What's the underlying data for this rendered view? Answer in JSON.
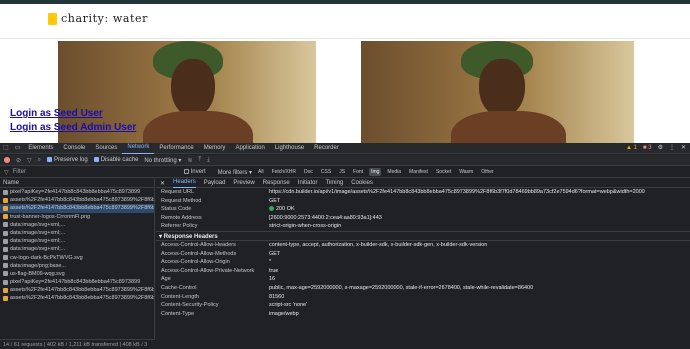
{
  "site": {
    "brand": "charity: water",
    "links": [
      "Login as Seed User",
      "Login as Seed Admin User"
    ]
  },
  "devtools": {
    "tabs": [
      "Elements",
      "Console",
      "Sources",
      "Network",
      "Performance",
      "Memory",
      "Application",
      "Lighthouse",
      "Recorder"
    ],
    "active_tab": "Network",
    "warnings": "1",
    "errors": "3",
    "toolbar": {
      "preserve_log": "Preserve log",
      "disable_cache": "Disable cache",
      "throttling": "No throttling"
    },
    "filter": {
      "placeholder": "Filter",
      "invert": "Invert",
      "more_filters": "More filters",
      "types": [
        "All",
        "Fetch/XHR",
        "Doc",
        "CSS",
        "JS",
        "Font",
        "Img",
        "Media",
        "Manifest",
        "Socket",
        "Wasm",
        "Other"
      ],
      "active_type": "Img"
    },
    "requests": {
      "header": "Name",
      "rows": [
        {
          "name": "pixel?apiKey=2fe4147bb8c843bb8ebba475c8973899",
          "icon_color": "#9aa0a6",
          "selected": false
        },
        {
          "name": "assets%2F2fe4147bb8c843bb8ebba475c8973899%2F8f6b3f7",
          "icon_color": "#e8a33d",
          "selected": false
        },
        {
          "name": "assets%2F2fe4147bb8c843bb8ebba475c8973899%2F8f6b3f7",
          "icon_color": "#e8a33d",
          "selected": true
        },
        {
          "name": "trust-banner-logos-CrronmFl.png",
          "icon_color": "#e8a33d",
          "selected": false
        },
        {
          "name": "data:image/svg+xml,...",
          "icon_color": "#9aa0a6",
          "selected": false
        },
        {
          "name": "data:image/svg+xml;...",
          "icon_color": "#9aa0a6",
          "selected": false
        },
        {
          "name": "data:image/svg+xml;...",
          "icon_color": "#9aa0a6",
          "selected": false
        },
        {
          "name": "data:image/svg+xml;...",
          "icon_color": "#9aa0a6",
          "selected": false
        },
        {
          "name": "cw-logo-dark-BcPkTWVG.svg",
          "icon_color": "#9aa0a6",
          "selected": false
        },
        {
          "name": "data:image/png;base...",
          "icon_color": "#9aa0a6",
          "selected": false
        },
        {
          "name": "us-flag-BM09-wqg.svg",
          "icon_color": "#9aa0a6",
          "selected": false
        },
        {
          "name": "pixel?apiKey=2fe4147bb8c843bb8ebba475c8973899",
          "icon_color": "#9aa0a6",
          "selected": false
        },
        {
          "name": "assets%2F2fe4147bb8c843bb8ebba475c8973899%2F8f6b3f7",
          "icon_color": "#e8a33d",
          "selected": false
        },
        {
          "name": "assets%2F2fe4147bb8c843bb8ebba475c8973899%2F8f6b3f7",
          "icon_color": "#e8a33d",
          "selected": false
        }
      ]
    },
    "status_bar": "14 / 61 requests | 402 kB / 1,211 kB transferred | 408 kB / 3",
    "detail_tabs": [
      "Headers",
      "Payload",
      "Preview",
      "Response",
      "Initiator",
      "Timing",
      "Cookies"
    ],
    "active_detail_tab": "Headers",
    "general": [
      {
        "k": "Request URL",
        "v": "https://cdn.builder.io/api/v1/image/assets%2F2fe4147bb8c843bb8ebba475c8973899%2F8f6b3f7f0d78469bb89a73cf2e7594d6?format=webp&width=2000"
      },
      {
        "k": "Request Method",
        "v": "GET"
      },
      {
        "k": "Status Code",
        "v": "200 OK"
      },
      {
        "k": "Remote Address",
        "v": "[2600:9000:2573:4400:2:cea4:aa80:93a1]:443"
      },
      {
        "k": "Referrer Policy",
        "v": "strict-origin-when-cross-origin"
      }
    ],
    "response_headers_title": "Response Headers",
    "response_headers": [
      {
        "k": "Access-Control-Allow-Headers",
        "v": "content-type, accept, authorization, x-builder-sdk, x-builder-sdk-gen, x-builder-sdk-version"
      },
      {
        "k": "Access-Control-Allow-Methods",
        "v": "GET"
      },
      {
        "k": "Access-Control-Allow-Origin",
        "v": "*"
      },
      {
        "k": "Access-Control-Allow-Private-Network",
        "v": "true"
      },
      {
        "k": "Age",
        "v": "16"
      },
      {
        "k": "Cache-Control",
        "v": "public, max-age=2592000000, s-maxage=2592000000, stale-if-error=2678400, stale-while-revalidate=86400"
      },
      {
        "k": "Content-Length",
        "v": "81560"
      },
      {
        "k": "Content-Security-Policy",
        "v": "script-src 'none'"
      },
      {
        "k": "Content-Type",
        "v": "image/webp"
      }
    ]
  }
}
